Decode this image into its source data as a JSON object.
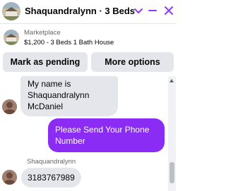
{
  "header": {
    "title": "Shaquandralynn · 3 Beds 1 ...",
    "accent_color": "#8a3cf6"
  },
  "listing": {
    "label": "Marketplace",
    "description": "$1,200 - 3 Beds 1 Bath House"
  },
  "actions": {
    "mark_pending": "Mark as pending",
    "more_options": "More options"
  },
  "messages": {
    "incoming_1": "My name is Shaquandralynn McDaniel",
    "outgoing_1": "Please Send Your Phone Number",
    "sender_name": "Shaquandralynn",
    "incoming_2": "3183767989"
  },
  "colors": {
    "outgoing_bubble": "#8a2cf4",
    "incoming_bubble": "#e4e6eb",
    "button_bg": "#e4e6eb"
  }
}
